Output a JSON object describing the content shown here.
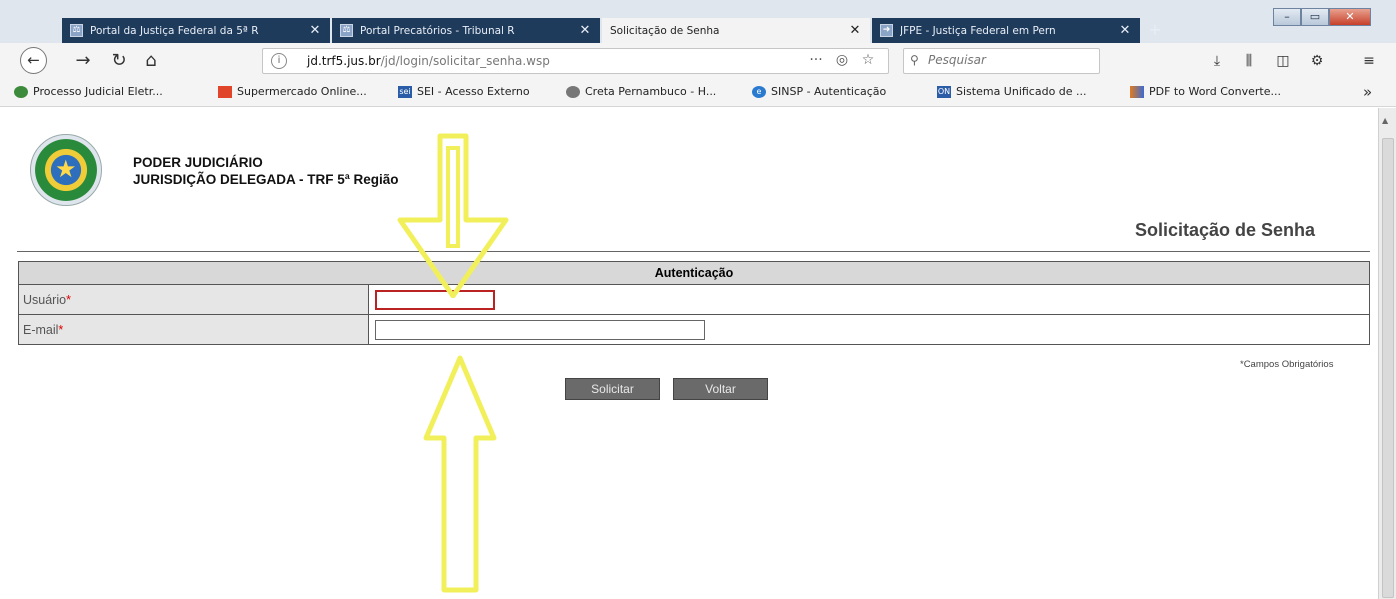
{
  "browser": {
    "tabs": [
      {
        "label": "Portal da Justiça Federal da 5ª R",
        "active": false
      },
      {
        "label": "Portal Precatórios - Tribunal R",
        "active": false
      },
      {
        "label": "Solicitação de Senha",
        "active": true
      },
      {
        "label": "JFPE - Justiça Federal em Pern",
        "active": false
      }
    ],
    "new_tab": "+",
    "url_host": "jd.trf5.jus.br",
    "url_path": "/jd/login/solicitar_senha.wsp",
    "url_actions": "···",
    "search_placeholder": "Pesquisar",
    "bookmarks": [
      {
        "label": "Processo Judicial Eletr...",
        "icon": "globe-icon",
        "color": "#3c8a3c"
      },
      {
        "label": "Supermercado Online...",
        "icon": "cart-icon",
        "color": "#e0452a"
      },
      {
        "label": "SEI - Acesso Externo",
        "icon": "sei-icon",
        "color": "#2a5ca8"
      },
      {
        "label": "Creta Pernambuco - H...",
        "icon": "globe-icon",
        "color": "#555555"
      },
      {
        "label": "SINSP - Autenticação",
        "icon": "ie-icon",
        "color": "#2a7ad0"
      },
      {
        "label": "Sistema Unificado de ...",
        "icon": "on-icon",
        "color": "#2a5ca8"
      },
      {
        "label": "PDF to Word Converte...",
        "icon": "pdf-icon",
        "color": "#e07a20"
      }
    ],
    "bookmarks_more": "»"
  },
  "page": {
    "org_line1": "PODER JUDICIÁRIO",
    "org_line2": "JURISDIÇÃO DELEGADA - TRF 5ª Região",
    "title": "Solicitação de Senha",
    "form_header": "Autenticação",
    "user_label": "Usuário",
    "email_label": "E-mail",
    "required_mark": "*",
    "user_value": "",
    "email_value": "",
    "required_note": "*Campos Obrigatórios",
    "submit_label": "Solicitar",
    "back_label": "Voltar"
  },
  "colors": {
    "tab_bg": "#1f3b5c",
    "arrow_color": "#f2f05a",
    "button_bg": "#6a6a6a"
  }
}
